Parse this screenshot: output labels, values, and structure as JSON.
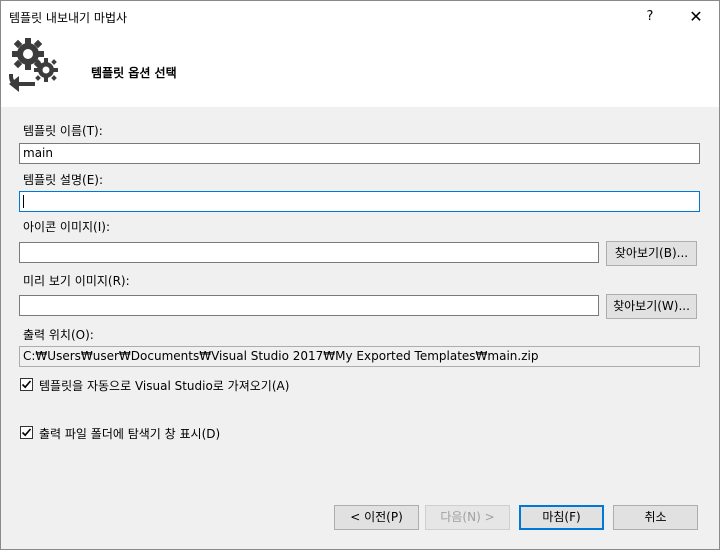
{
  "window": {
    "title": "템플릿 내보내기 마법사",
    "help_label": "?",
    "close_label": "✕"
  },
  "header": {
    "title": "템플릿 옵션 선택"
  },
  "form": {
    "name_label": "템플릿 이름(T):",
    "name_value": "main",
    "desc_label": "템플릿 설명(E):",
    "desc_value": "",
    "icon_label": "아이콘 이미지(I):",
    "icon_value": "",
    "icon_browse": "찾아보기(B)...",
    "preview_label": "미리 보기 이미지(R):",
    "preview_value": "",
    "preview_browse": "찾아보기(W)...",
    "output_label": "출력 위치(O):",
    "output_value": "C:₩Users₩user₩Documents₩Visual Studio 2017₩My Exported Templates₩main.zip",
    "auto_import_label": "템플릿을 자동으로 Visual Studio로 가져오기(A)",
    "auto_import_checked": true,
    "show_explorer_label": "출력 파일 폴더에 탐색기 창 표시(D)",
    "show_explorer_checked": true
  },
  "footer": {
    "prev": "< 이전(P)",
    "next": "다음(N) >",
    "finish": "마침(F)",
    "cancel": "취소"
  },
  "icons": {
    "header": "gear-export-icon",
    "check": "checkmark-icon"
  }
}
